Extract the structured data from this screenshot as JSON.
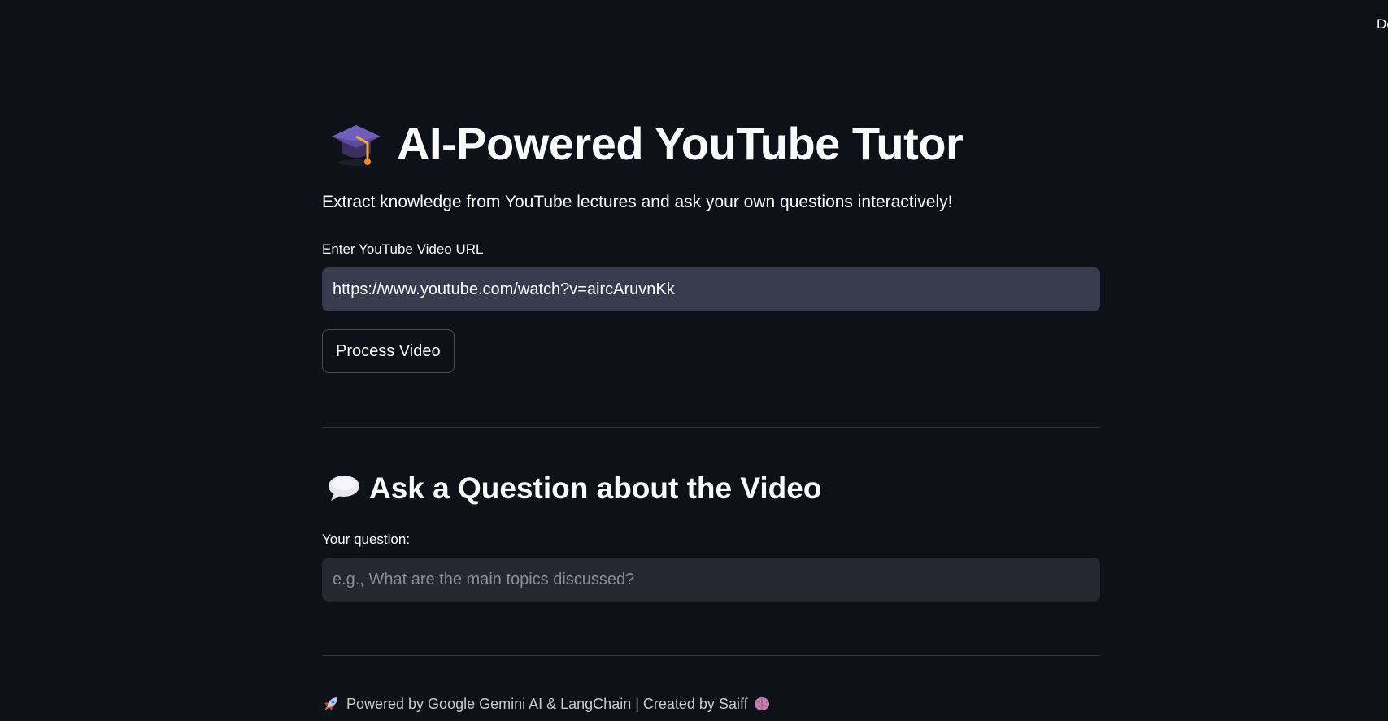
{
  "topbar": {
    "deploy_partial": "De"
  },
  "header": {
    "icon": "graduation-cap-icon",
    "title": "AI-Powered YouTube Tutor",
    "subtitle": "Extract knowledge from YouTube lectures and ask your own questions interactively!"
  },
  "url_form": {
    "label": "Enter YouTube Video URL",
    "value": "https://www.youtube.com/watch?v=aircAruvnKk",
    "button_label": "Process Video"
  },
  "question_section": {
    "icon": "speech-balloon-icon",
    "heading": "Ask a Question about the Video",
    "label": "Your question:",
    "placeholder": "e.g., What are the main topics discussed?",
    "value": ""
  },
  "footer": {
    "leading_icon": "rocket-icon",
    "text": "Powered by Google Gemini AI & LangChain | Created by Saiff",
    "trailing_icon": "brain-icon"
  },
  "colors": {
    "background": "#0e1117",
    "url_input_bg": "#363b4e",
    "question_input_bg": "#262730",
    "text": "#fafafa"
  }
}
